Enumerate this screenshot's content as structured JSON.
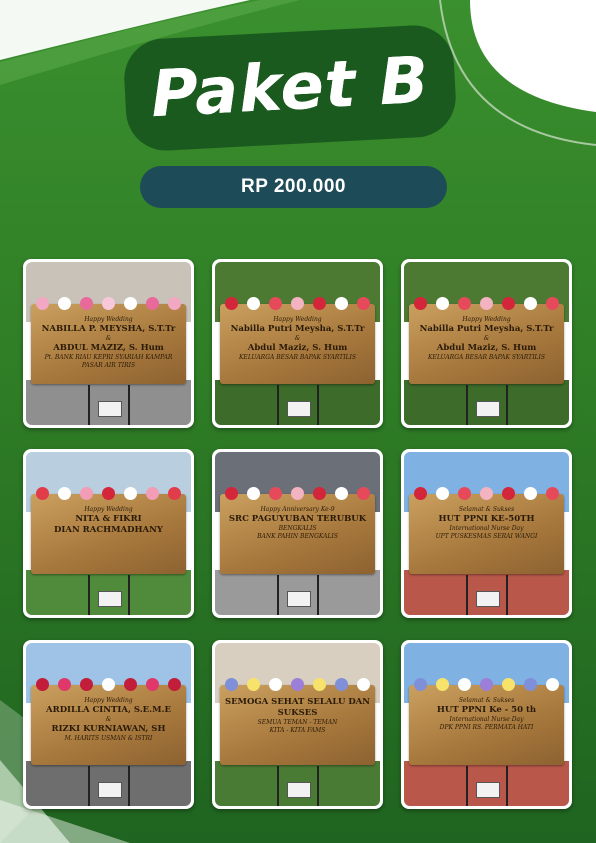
{
  "title": "Paket B",
  "price": "RP 200.000",
  "colors": {
    "bg": "#2f7d26",
    "price_bg": "#1d4b57",
    "title_outline": "#1a5a1e"
  },
  "cards": [
    {
      "line1": "Happy Wedding",
      "line2": "NABILLA P. MEYSHA, S.T.Tr",
      "line3": "&",
      "line4": "ABDUL MAZIZ, S. Hum",
      "line5": "Pt. BANK RIAU KEPRI SYARIAH KAMPAR PASAR AIR TIRIS",
      "scene": "building",
      "flowers": "pink"
    },
    {
      "line1": "Happy Wedding",
      "line2": "Nabilla Putri Meysha, S.T.Tr",
      "line3": "&",
      "line4": "Abdul Maziz, S. Hum",
      "line5": "KELUARGA BESAR BAPAK SYARTILIS",
      "scene": "garden",
      "flowers": "red"
    },
    {
      "line1": "Happy Wedding",
      "line2": "Nabilla Putri Meysha, S.T.Tr",
      "line3": "&",
      "line4": "Abdul Maziz, S. Hum",
      "line5": "KELUARGA BESAR BAPAK SYARTILIS",
      "scene": "garden",
      "flowers": "red"
    },
    {
      "line1": "Happy Wedding",
      "line2": "NITA & FIKRI",
      "line3": "",
      "line4": "DIAN RACHMADHANY",
      "line5": "",
      "scene": "yard",
      "flowers": "mixed"
    },
    {
      "line1": "Happy Anniversary Ke-9",
      "line2": "SRC PAGUYUBAN TERUBUK",
      "line3": "BENGKALIS",
      "line4": "",
      "line5": "BANK PAHIN BENGKALIS",
      "scene": "shop",
      "flowers": "red"
    },
    {
      "line1": "Selamat & Sukses",
      "line2": "HUT PPNI KE-50TH",
      "line3": "International Nurse Day",
      "line4": "",
      "line5": "UPT PUSKESMAS SERAI WANGI",
      "scene": "sky",
      "flowers": "red"
    },
    {
      "line1": "Happy Wedding",
      "line2": "ARDILLA CINTIA, S.E.M.E",
      "line3": "&",
      "line4": "RIZKI KURNIAWAN, SH",
      "line5": "M. HARITS USMAN & ISTRI",
      "scene": "tree",
      "flowers": "crimson"
    },
    {
      "line1": "",
      "line2": "SEMOGA SEHAT SELALU DAN SUKSES",
      "line3": "SEMUA TEMAN - TEMAN",
      "line4": "",
      "line5": "KITA - KITA FAMS",
      "scene": "porch",
      "flowers": "blue"
    },
    {
      "line1": "Selamat & Sukses",
      "line2": "HUT PPNI Ke - 50 th",
      "line3": "International Nurse Day",
      "line4": "",
      "line5": "DPK PPNI RS. PERMATA HATI",
      "scene": "sky",
      "flowers": "blue"
    }
  ]
}
